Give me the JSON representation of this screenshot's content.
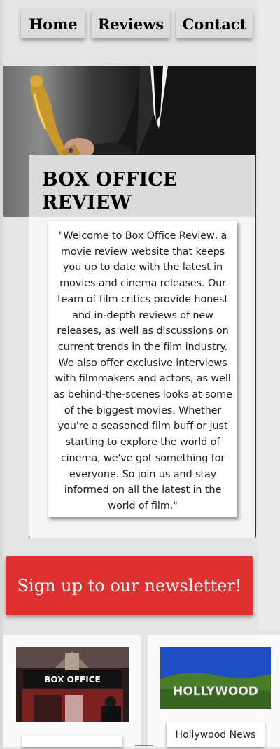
{
  "nav": {
    "items": [
      {
        "label": "Home"
      },
      {
        "label": "Reviews"
      },
      {
        "label": "Contact"
      }
    ]
  },
  "intro": {
    "title": "BOX OFFICE REVIEW",
    "text": "\"Welcome to Box Office Review, a movie review website that keeps you up to date with the latest in movies and cinema releases. Our team of film critics provide honest and in-depth reviews of new releases, as well as discussions on current trends in the film industry. We also offer exclusive interviews with filmmakers and actors, as well as behind-the-scenes looks at some of the biggest movies. Whether you're a seasoned film buff or just starting to explore the world of cinema, we've got something for everyone. So join us and stay informed on all the latest in the world of film.\""
  },
  "newsletter": {
    "label": "Sign up to our newsletter!"
  },
  "cards": [
    {
      "sign_text": "BOX OFFICE",
      "caption": ""
    },
    {
      "sign_text": "HOLLYWOOD",
      "caption": "Hollywood News"
    }
  ],
  "colors": {
    "accent_red": "#e03131",
    "page_bg": "#e4e4e4",
    "nav_bg": "#dcdcdc"
  }
}
